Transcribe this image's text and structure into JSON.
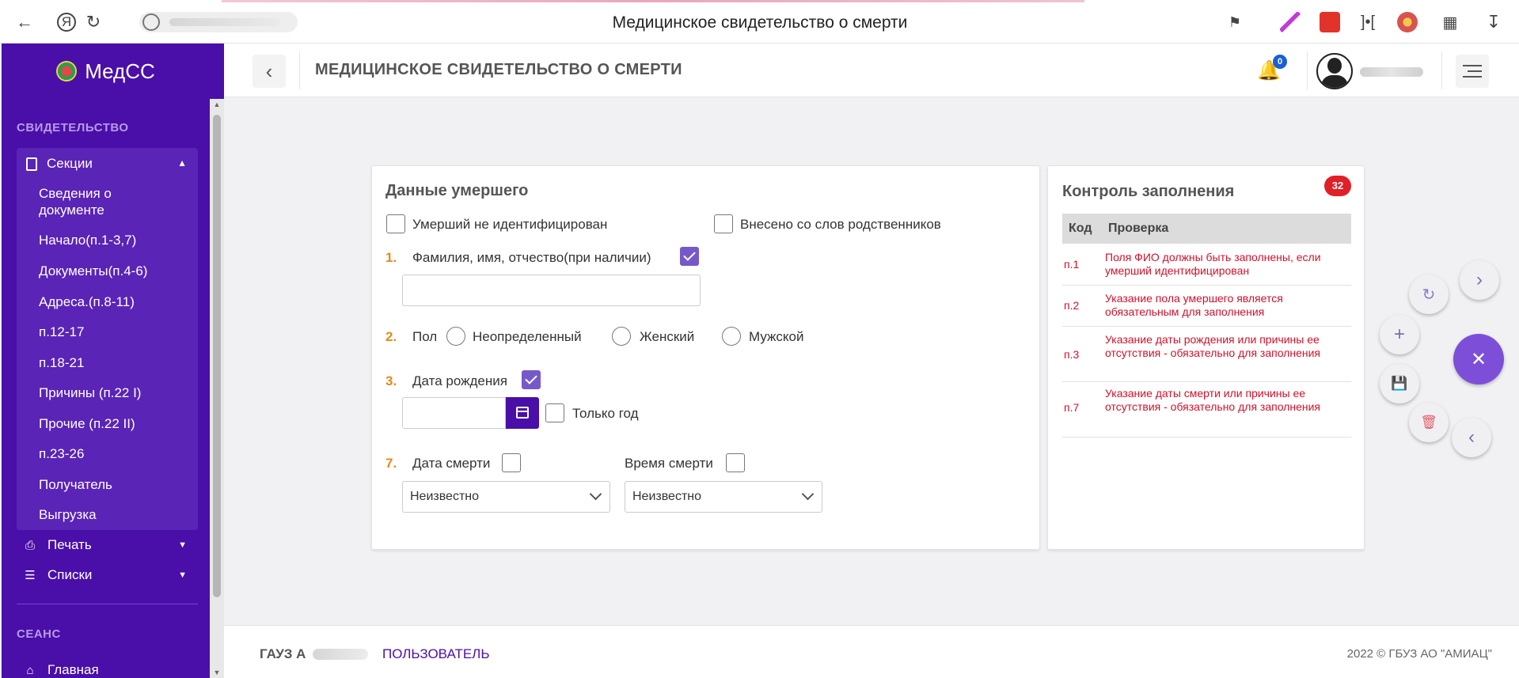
{
  "browser": {
    "title": "Медицинское свидетельство о смерти"
  },
  "sidebar": {
    "brand": "МедСС",
    "section_certificate": "СВИДЕТЕЛЬСТВО",
    "sections_group": "Секции",
    "sub_items": [
      "Сведения о документе",
      "Начало(п.1-3,7)",
      "Документы(п.4-6)",
      "Адреса.(п.8-11)",
      "п.12-17",
      "п.18-21",
      "Причины (п.22 I)",
      "Прочие (п.22 II)",
      "п.23-26",
      "Получатель",
      "Выгрузка"
    ],
    "print": "Печать",
    "lists": "Списки",
    "section_session": "СЕАНС",
    "home": "Главная"
  },
  "header": {
    "page_title": "МЕДИЦИНСКОЕ СВИДЕТЕЛЬСТВО О СМЕРТИ",
    "notifications_count": "0"
  },
  "form": {
    "title": "Данные умершего",
    "not_identified": "Умерший не идентифицирован",
    "from_relatives": "Внесено со слов родственников",
    "f1_num": "1.",
    "f1_label": "Фамилия, имя, отчество(при наличии)",
    "f2_num": "2.",
    "f2_label": "Пол",
    "gender_options": [
      "Неопределенный",
      "Женский",
      "Мужской"
    ],
    "f3_num": "3.",
    "f3_label": "Дата рождения",
    "only_year": "Только год",
    "f7_num": "7.",
    "death_date_label": "Дата смерти",
    "death_time_label": "Время смерти",
    "death_date_value": "Неизвестно",
    "death_time_value": "Неизвестно"
  },
  "control": {
    "title": "Контроль заполнения",
    "count": "32",
    "col_code": "Код",
    "col_check": "Проверка",
    "rows": [
      {
        "code": "п.1",
        "text": "Поля ФИО должны быть заполнены, если умерший идентифицирован"
      },
      {
        "code": "п.2",
        "text": "Указание пола умершего является обязательным для заполнения"
      },
      {
        "code": "п.3",
        "text": "Указание даты рождения или причины ее отсутствия - обязательно для заполнения"
      },
      {
        "code": "п.7",
        "text": "Указание даты смерти или причины ее отсутствия - обязательно для заполнения"
      }
    ]
  },
  "footer": {
    "org_prefix": "ГАУЗ А",
    "user": "ПОЛЬЗОВАТЕЛЬ",
    "copyright": "2022 © ГБУЗ АО \"АМИАЦ\""
  },
  "colors": {
    "sidebar_bg": "#4a0fa8",
    "accent": "#7659c9",
    "field_number": "#e28b1b",
    "error_text": "#d0112b",
    "badge_red": "#e01f26",
    "fab_primary": "#7d4fd8"
  }
}
